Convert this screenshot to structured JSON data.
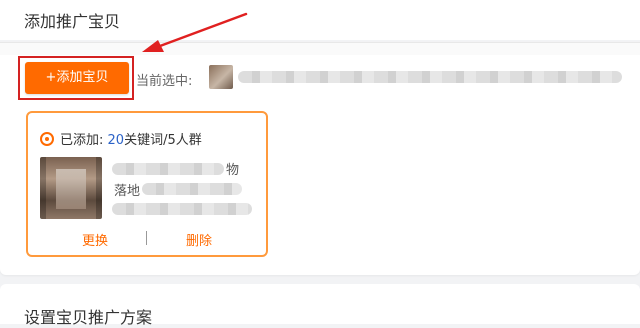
{
  "header": {
    "title": "添加推广宝贝"
  },
  "toolbar": {
    "add_button_label": "+添加宝贝",
    "selected_label": "当前选中:"
  },
  "product_card": {
    "status_prefix": "已添加:",
    "keyword_count": "20",
    "keyword_suffix": "关键词/5人群",
    "desc_line1_end": "物",
    "desc_line2_start": "落地",
    "replace_label": "更换",
    "delete_label": "删除"
  },
  "next_section": {
    "title": "设置宝贝推广方案"
  },
  "colors": {
    "accent": "#ff6a00",
    "highlight_box": "#d42222",
    "arrow": "#e02020",
    "keyword_count": "#2c63c8",
    "card_border": "#ff9a3c"
  },
  "icons": {
    "radio": "radio-selected-icon",
    "annotation_arrow": "red-arrow-annotation"
  }
}
